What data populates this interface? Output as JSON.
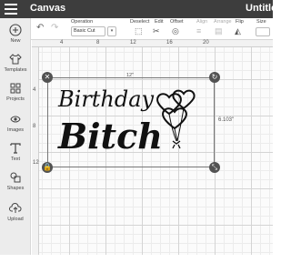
{
  "app": {
    "title": "Canvas",
    "document_title": "Untitled"
  },
  "toolbar": {
    "operation_label": "Operation",
    "operation_value": "Basic Cut",
    "deselect_label": "Deselect",
    "edit_label": "Edit",
    "offset_label": "Offset",
    "align_label": "Align",
    "arrange_label": "Arrange",
    "flip_label": "Flip",
    "size_label": "Size"
  },
  "sidebar": {
    "items": [
      {
        "label": "New",
        "icon": "plus-circle-icon"
      },
      {
        "label": "Templates",
        "icon": "shirt-icon"
      },
      {
        "label": "Projects",
        "icon": "grid-icon"
      },
      {
        "label": "Images",
        "icon": "image-icon"
      },
      {
        "label": "Text",
        "icon": "text-icon"
      },
      {
        "label": "Shapes",
        "icon": "shapes-icon"
      },
      {
        "label": "Upload",
        "icon": "upload-icon"
      }
    ]
  },
  "ruler": {
    "top_marks": [
      "4",
      "8",
      "12",
      "16",
      "20"
    ],
    "left_marks": [
      "4",
      "8",
      "12"
    ]
  },
  "selection": {
    "width_label": "12\"",
    "height_label": "6.103\""
  },
  "design": {
    "line1": "Birthday",
    "line2": "Bitch"
  },
  "colors": {
    "topbar": "#3d3d3d",
    "sidebar": "#ececec",
    "handle": "#525252"
  }
}
